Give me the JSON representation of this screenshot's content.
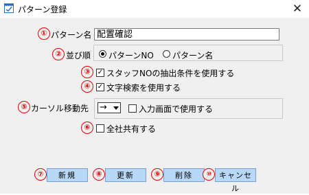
{
  "window": {
    "title": "パターン登録",
    "close_glyph": "✕"
  },
  "markers": [
    "①",
    "②",
    "③",
    "④",
    "⑤",
    "⑥",
    "⑦",
    "⑧",
    "⑨",
    "⑩"
  ],
  "pattern_name": {
    "label": "パターン名",
    "value": "配置確認"
  },
  "sort_order": {
    "label": "並び順",
    "options": [
      {
        "label": "パターンNO",
        "selected": true
      },
      {
        "label": "パターン名",
        "selected": false
      }
    ]
  },
  "staff_no_checkbox": {
    "label": "スタッフNOの抽出条件を使用する",
    "checked": true
  },
  "text_search_checkbox": {
    "label": "文字検索を使用する",
    "checked": true
  },
  "cursor_direction": {
    "label": "カーソル移動先",
    "selected_value": "→",
    "input_screen_checkbox": {
      "label": "入力画面で使用する",
      "checked": false
    }
  },
  "shared_checkbox": {
    "label": "全社共有する",
    "checked": false
  },
  "buttons": {
    "new": "新規",
    "update": "更新",
    "delete": "削除",
    "cancel": "キャンセル"
  },
  "colors": {
    "marker": "#e30000",
    "button_bg": "#b8d8f8"
  }
}
